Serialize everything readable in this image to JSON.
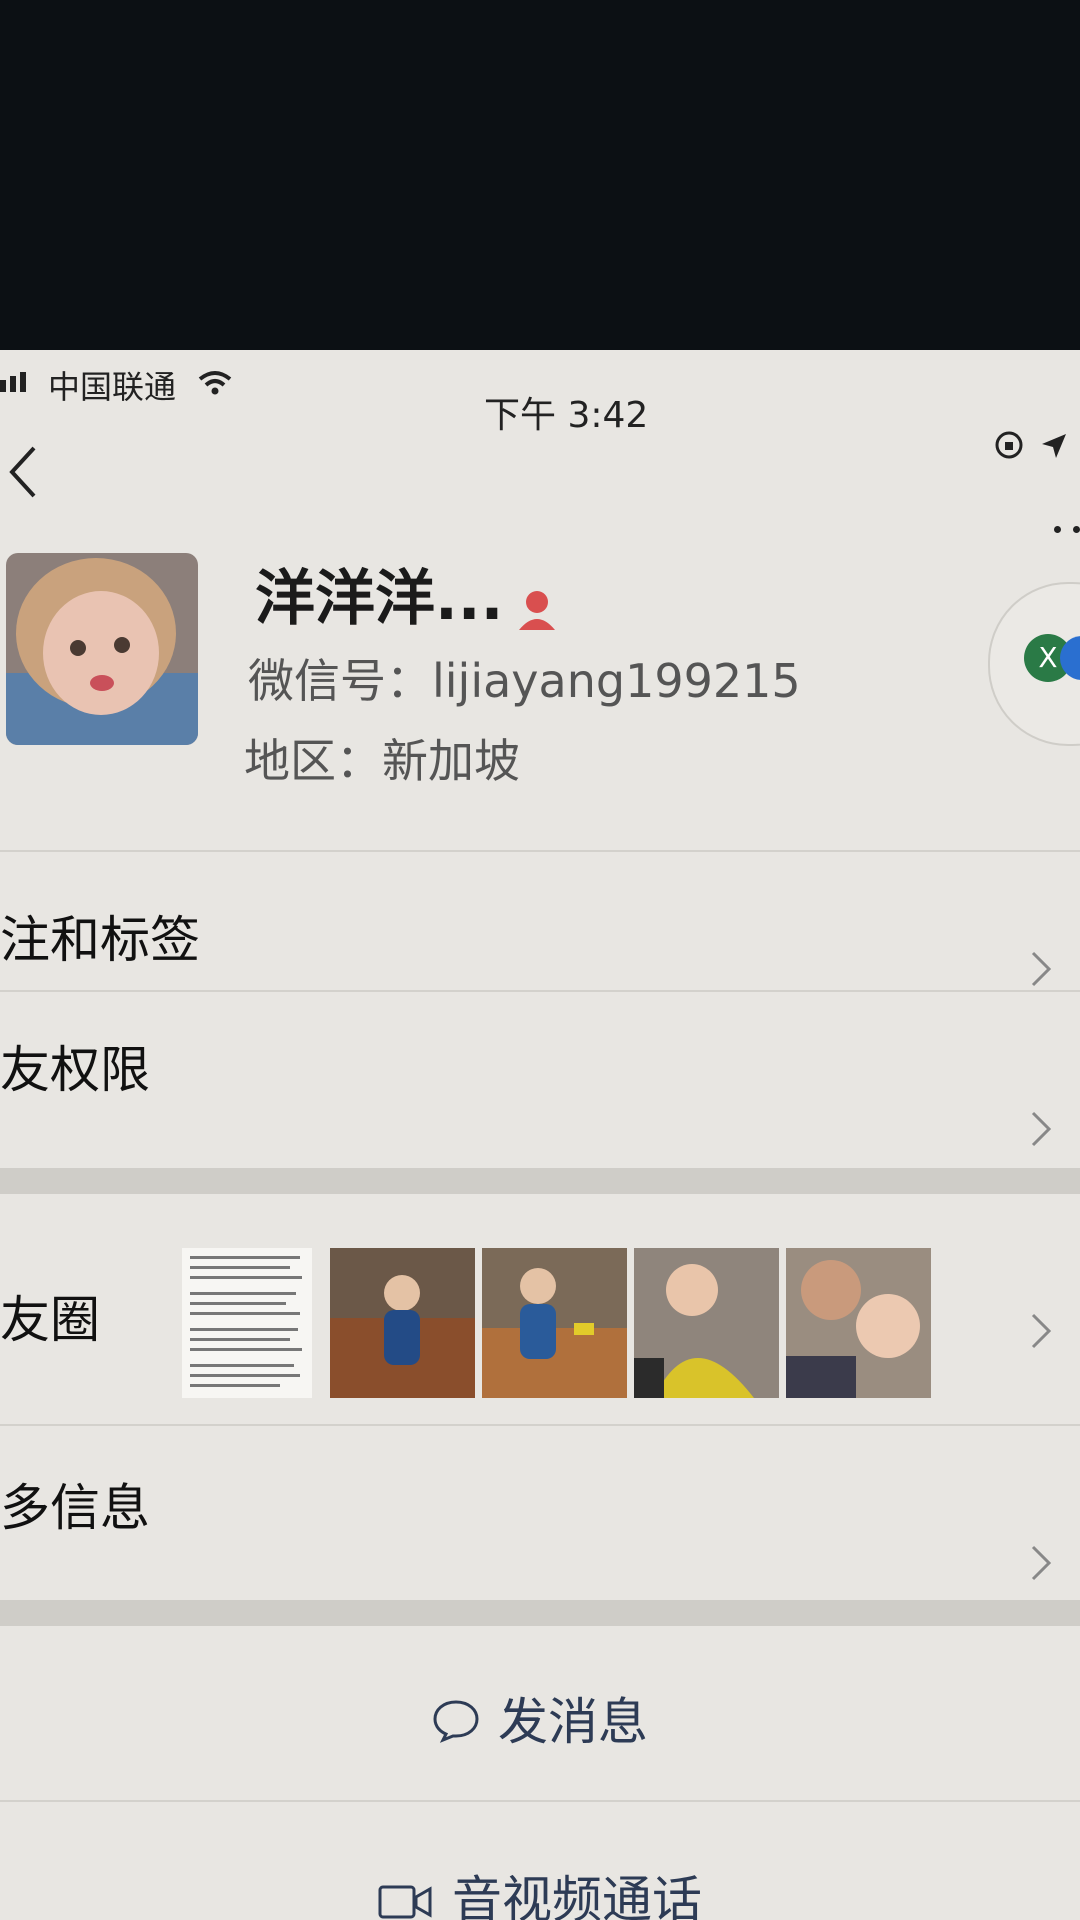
{
  "status_bar": {
    "carrier": "中国联通",
    "time": "下午 3:42"
  },
  "profile": {
    "display_name": "洋洋洋...",
    "wechat_id": "微信号：lijiayang199215",
    "region": "地区：新加坡",
    "mini_badge_letter": "X"
  },
  "menu": [
    {
      "label": "备注和标签"
    },
    {
      "label": "朋友权限"
    },
    {
      "label": "朋友圈"
    },
    {
      "label": "更多信息"
    }
  ],
  "actions": {
    "send_message": "发消息",
    "video_call": "音视频通话"
  },
  "colors": {
    "accent": "#2d3b55",
    "gender_icon": "#d94f4f",
    "background": "#e8e6e2"
  }
}
